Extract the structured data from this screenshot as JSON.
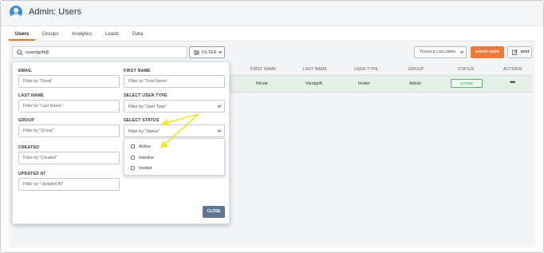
{
  "header": {
    "title": "Admin: Users",
    "avatar_icon": "user-avatar-icon"
  },
  "tabs": [
    {
      "label": "Users",
      "active": true
    },
    {
      "label": "Groups",
      "active": false
    },
    {
      "label": "Analytics",
      "active": false
    },
    {
      "label": "Leads",
      "active": false
    },
    {
      "label": "Data",
      "active": false
    }
  ],
  "toolbar": {
    "search_value": "nvandgrift@",
    "filter_label": "FILTER",
    "toggle_columns_label": "TOGGLE COLUMNS",
    "invite_user_label": "INVITE USER",
    "edit_label": "EDIT"
  },
  "table": {
    "columns": [
      "FIRST NAME",
      "LAST NAME",
      "USER TYPE",
      "GROUP",
      "STATUS",
      "ACTIONS"
    ],
    "rows": [
      {
        "first_name": "Nicole",
        "last_name": "Vandgrift",
        "user_type": "broker",
        "group": "Admin",
        "status": "ACTIVE",
        "actions": "•••"
      }
    ]
  },
  "filter_panel": {
    "email_label": "EMAIL",
    "email_placeholder": "Filter by \"Email\"",
    "first_name_label": "FIRST NAME",
    "first_name_placeholder": "Filter by \"First Name\"",
    "last_name_label": "LAST NAME",
    "last_name_placeholder": "Filter by \"Last Name\"",
    "user_type_label": "SELECT USER TYPE",
    "user_type_value": "Filter by \"User Type\"",
    "group_label": "GROUP",
    "group_placeholder": "Filter by \"Group\"",
    "status_label": "SELECT STATUS",
    "status_value": "Filter by \"Status\"",
    "created_label": "CREATED",
    "created_placeholder": "Filter by \"Created\"",
    "updated_label": "UPDATED AT",
    "updated_placeholder": "Filter by \"Updated At\"",
    "status_options": [
      "Active",
      "Inactive",
      "Invited"
    ],
    "close_label": "CLOSE"
  },
  "colors": {
    "accent": "#ef7a3a",
    "close_button": "#5d7591",
    "status_active": "#56b86a",
    "annotation_arrow": "#f5e62b"
  }
}
